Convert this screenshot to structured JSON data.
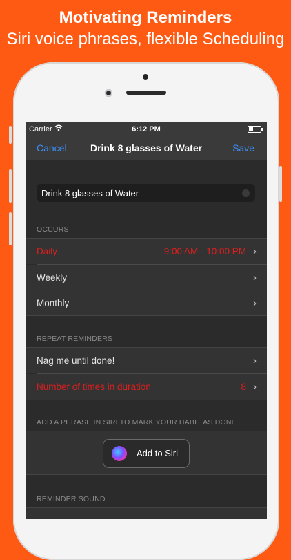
{
  "promo": {
    "title": "Motivating Reminders",
    "subtitle": "Siri voice phrases, flexible Scheduling"
  },
  "status": {
    "carrier": "Carrier",
    "time": "6:12 PM",
    "battery_level": 0.4
  },
  "nav": {
    "cancel": "Cancel",
    "title": "Drink 8 glasses of Water",
    "save": "Save"
  },
  "name_field": {
    "value": "Drink 8 glasses of Water"
  },
  "occurs": {
    "header": "OCCURS",
    "items": [
      {
        "label": "Daily",
        "value": "9:00 AM - 10:00 PM"
      },
      {
        "label": "Weekly",
        "value": ""
      },
      {
        "label": "Monthly",
        "value": ""
      }
    ]
  },
  "repeat": {
    "header": "REPEAT REMINDERS",
    "items": [
      {
        "label": "Nag me until done!",
        "value": ""
      },
      {
        "label": "Number of times in duration",
        "value": "8"
      }
    ]
  },
  "siri": {
    "header": "ADD A PHRASE IN SIRI TO MARK YOUR HABIT AS DONE",
    "button": "Add to Siri"
  },
  "sound": {
    "header": "REMINDER SOUND"
  },
  "colors": {
    "background": "#ff5a14",
    "accent": "#3d8ef5",
    "alert": "#e01e1e"
  }
}
